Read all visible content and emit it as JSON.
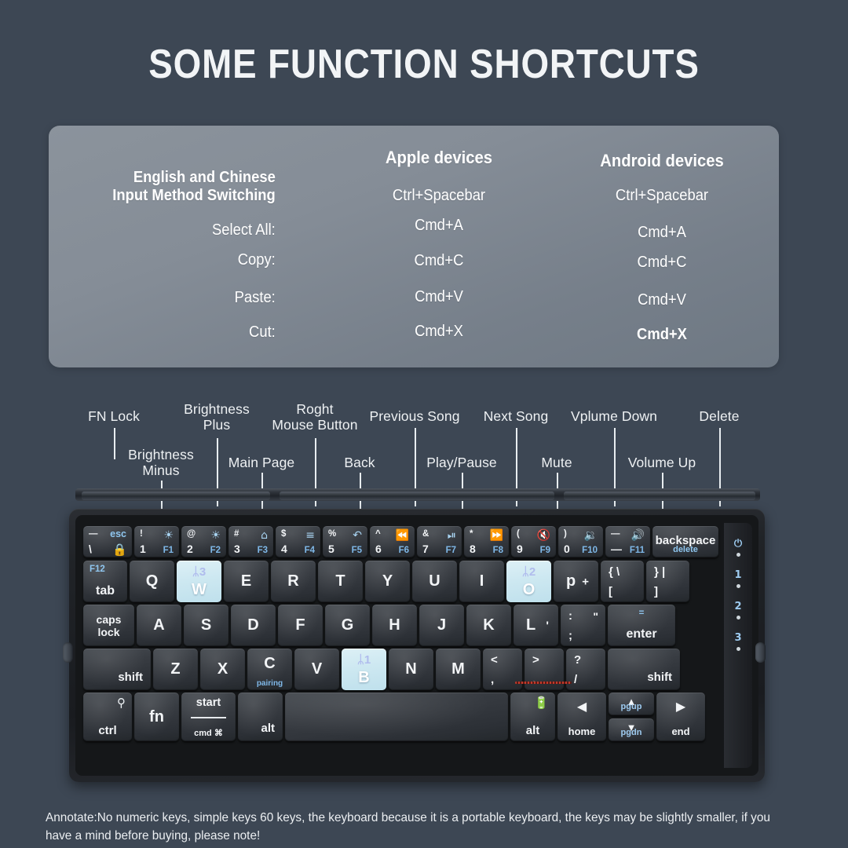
{
  "page": {
    "title": "SOME FUNCTION SHORTCUTS",
    "background_color": "#3d4754",
    "accent_blue": "#8fc6ef",
    "bt_key_color": "#cde8f1"
  },
  "shortcut_table": {
    "panel_color": "#858d97",
    "headers": {
      "row_label_col": "",
      "apple": "Apple devices",
      "android": "Android devices"
    },
    "rows": [
      {
        "label_line1": "English and Chinese",
        "label_line2": "Input Method Switching",
        "apple": "Ctrl+Spacebar",
        "android": "Ctrl+Spacebar"
      },
      {
        "label_line1": "Select All:",
        "label_line2": "",
        "apple": "Cmd+A",
        "android": "Cmd+A"
      },
      {
        "label_line1": "Copy:",
        "label_line2": "",
        "apple": "Cmd+C",
        "android": "Cmd+C"
      },
      {
        "label_line1": "Paste:",
        "label_line2": "",
        "apple": "Cmd+V",
        "android": "Cmd+V"
      },
      {
        "label_line1": "Cut:",
        "label_line2": "",
        "apple": "Cmd+X",
        "android": "Cmd+X"
      }
    ]
  },
  "callouts": {
    "top_row": [
      {
        "text": "FN Lock"
      },
      {
        "text": "Brightness\nPlus"
      },
      {
        "text": "Roght\nMouse Button"
      },
      {
        "text": "Previous Song"
      },
      {
        "text": "Next Song"
      },
      {
        "text": "Vplume Down"
      },
      {
        "text": "Delete"
      }
    ],
    "bottom_row": [
      {
        "text": "Brightness\nMinus"
      },
      {
        "text": "Main Page"
      },
      {
        "text": "Back"
      },
      {
        "text": "Play/Pause"
      },
      {
        "text": "Mute"
      },
      {
        "text": "Volume Up"
      }
    ]
  },
  "keyboard": {
    "function_row": [
      {
        "name": "esc",
        "tl": "—",
        "tr": "esc",
        "bl": "\\",
        "br_icon": "lock-fn"
      },
      {
        "name": "f1",
        "tl": "!",
        "tr_icon": "☀",
        "bl": "1",
        "br": "F1"
      },
      {
        "name": "f2",
        "tl": "@",
        "tr_icon": "☀",
        "bl": "2",
        "br": "F2"
      },
      {
        "name": "f3",
        "tl": "#",
        "tr_icon": "⌂",
        "bl": "3",
        "br": "F3"
      },
      {
        "name": "f4",
        "tl": "$",
        "tr_icon": "≡",
        "bl": "4",
        "br": "F4"
      },
      {
        "name": "f5",
        "tl": "%",
        "tr_icon": "↶",
        "bl": "5",
        "br": "F5"
      },
      {
        "name": "f6",
        "tl": "^",
        "tr_icon": "⏪",
        "bl": "6",
        "br": "F6"
      },
      {
        "name": "f7",
        "tl": "&",
        "tr_icon": "⏯",
        "bl": "7",
        "br": "F7"
      },
      {
        "name": "f8",
        "tl": "*",
        "tr_icon": "⏩",
        "bl": "8",
        "br": "F8"
      },
      {
        "name": "f9",
        "tl": "(",
        "tr_icon": "🔇",
        "bl": "9",
        "br": "F9"
      },
      {
        "name": "f10",
        "tl": ")",
        "tr_icon": "🔉",
        "bl": "0",
        "br": "F10"
      },
      {
        "name": "f11",
        "tl": "—",
        "tr_icon": "🔊",
        "bl": "—",
        "br": "F11"
      },
      {
        "name": "backspace",
        "main": "backspace",
        "sub": "delete"
      }
    ],
    "row_qwerty": [
      {
        "name": "tab",
        "top": "F12",
        "main": "tab"
      },
      {
        "name": "q",
        "main": "Q"
      },
      {
        "name": "w",
        "main": "W",
        "bt": true,
        "bt_num": "3"
      },
      {
        "name": "e",
        "main": "E"
      },
      {
        "name": "r",
        "main": "R"
      },
      {
        "name": "t",
        "main": "T"
      },
      {
        "name": "y",
        "main": "Y"
      },
      {
        "name": "u",
        "main": "U"
      },
      {
        "name": "i",
        "main": "I"
      },
      {
        "name": "o",
        "main": "O",
        "bt": true,
        "bt_num": "2"
      },
      {
        "name": "p",
        "main": "p",
        "extra": "+"
      },
      {
        "name": "bracket-left",
        "upper": "{ \\",
        "lower": "["
      },
      {
        "name": "bracket-right",
        "upper": "} |",
        "lower": "]"
      }
    ],
    "row_home": [
      {
        "name": "caps-lock",
        "line1": "caps",
        "line2": "lock"
      },
      {
        "name": "a",
        "main": "A"
      },
      {
        "name": "s",
        "main": "S"
      },
      {
        "name": "d",
        "main": "D"
      },
      {
        "name": "f",
        "main": "F"
      },
      {
        "name": "g",
        "main": "G"
      },
      {
        "name": "h",
        "main": "H"
      },
      {
        "name": "j",
        "main": "J"
      },
      {
        "name": "k",
        "main": "K"
      },
      {
        "name": "l",
        "main": "L",
        "extra": "'"
      },
      {
        "name": "semicolon",
        "upper": ":",
        "lower": ";",
        "extra": "\""
      },
      {
        "name": "enter",
        "top": "=",
        "main": "enter"
      }
    ],
    "row_shift": [
      {
        "name": "shift-left",
        "main": "shift"
      },
      {
        "name": "z",
        "main": "Z"
      },
      {
        "name": "x",
        "main": "X"
      },
      {
        "name": "c",
        "main": "C",
        "sub": "pairing"
      },
      {
        "name": "v",
        "main": "V"
      },
      {
        "name": "b",
        "main": "B",
        "bt": true,
        "bt_num": "1"
      },
      {
        "name": "n",
        "main": "N"
      },
      {
        "name": "m",
        "main": "M"
      },
      {
        "name": "comma",
        "upper": "<",
        "lower": ","
      },
      {
        "name": "period",
        "upper": ">",
        "lower": "."
      },
      {
        "name": "slash",
        "upper": "?",
        "lower": "/"
      },
      {
        "name": "shift-right",
        "main": "shift"
      }
    ],
    "row_bottom": [
      {
        "name": "ctrl",
        "icon": "search-icon",
        "main": "ctrl"
      },
      {
        "name": "fn",
        "main": "fn"
      },
      {
        "name": "start-cmd",
        "top": "start",
        "bottom": "cmd ⌘"
      },
      {
        "name": "alt-left",
        "main": "alt"
      },
      {
        "name": "spacebar",
        "main": ""
      },
      {
        "name": "alt-right",
        "icon": "battery-icon",
        "main": "alt"
      },
      {
        "name": "home",
        "glyph": "◀",
        "main": "home"
      },
      {
        "name": "pgup",
        "glyph": "▲",
        "main": "pgup"
      },
      {
        "name": "pgdn",
        "glyph": "▼",
        "main": "pgdn"
      },
      {
        "name": "end",
        "glyph": "▶",
        "main": "end"
      }
    ],
    "side_indicators": [
      {
        "name": "power",
        "label": "⏻"
      },
      {
        "name": "bluetooth-channel-1",
        "label": "␴1"
      },
      {
        "name": "bluetooth-channel-2",
        "label": "␴2"
      },
      {
        "name": "bluetooth-channel-3",
        "label": "␴3"
      }
    ]
  },
  "annotation": {
    "text": "Annotate:No numeric keys, simple keys 60 keys, the keyboard because it is a portable keyboard, the keys may be slightly smaller, if you have a mind before buying, please note!"
  }
}
